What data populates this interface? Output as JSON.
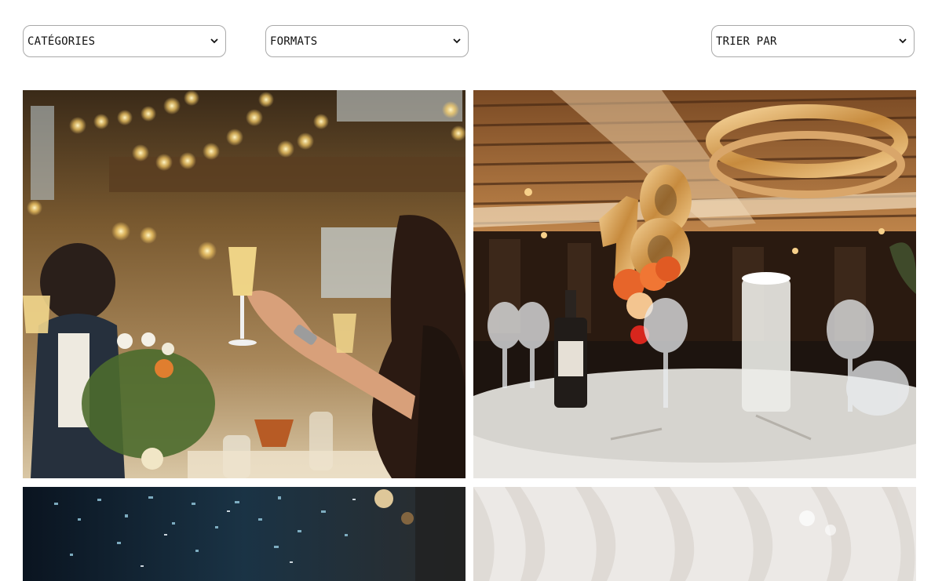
{
  "filters": {
    "categories": {
      "selected": "CATÉGORIES"
    },
    "formats": {
      "selected": "FORMATS"
    },
    "sort": {
      "selected": "TRIER PAR"
    }
  },
  "gallery": {
    "photos": [
      {
        "subject": "wedding-toast-photo"
      },
      {
        "subject": "18th-birthday-balloons-dining-photo"
      },
      {
        "subject": "confetti-party-photo"
      },
      {
        "subject": "white-drapery-venue-photo"
      }
    ]
  }
}
